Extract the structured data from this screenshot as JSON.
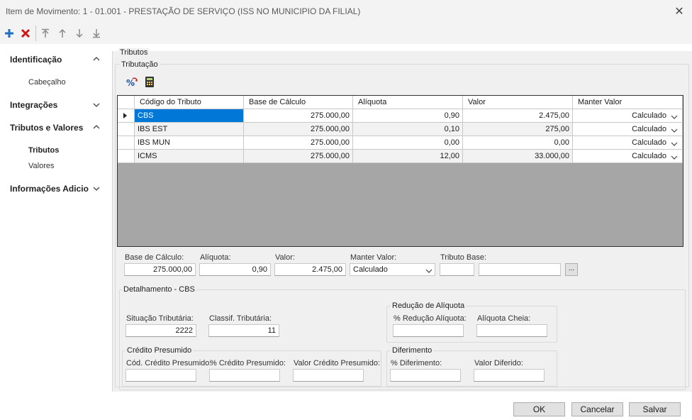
{
  "window": {
    "title": "Item de Movimento: 1 - 01.001 - PRESTAÇÃO DE SERVIÇO (ISS NO MUNICIPIO DA FILIAL)"
  },
  "toolbar": {
    "icons": [
      "add-icon",
      "delete-icon",
      "move-top-icon",
      "move-up-icon",
      "move-down-icon",
      "move-bottom-icon"
    ],
    "colors": {
      "add": "#1e6fc4",
      "delete": "#d01818",
      "disabled": "#8a8a8a"
    }
  },
  "nav": {
    "groups": [
      {
        "label": "Identificação",
        "items": [
          "Cabeçalho"
        ]
      },
      {
        "label": "Integrações"
      },
      {
        "label": "Tributos e Valores",
        "items": [
          "Tributos",
          "Valores"
        ]
      },
      {
        "label": "Informações Adicio"
      }
    ],
    "active_item": "Tributos"
  },
  "section": {
    "title": "Tributos",
    "subtitle": "Tributação"
  },
  "grid": {
    "columns": [
      "Código do Tributo",
      "Base de Cálculo",
      "Alíquota",
      "Valor",
      "Manter Valor"
    ],
    "rows": [
      [
        "CBS",
        "275.000,00",
        "0,90",
        "2.475,00",
        "Calculado"
      ],
      [
        "IBS EST",
        "275.000,00",
        "0,10",
        "275,00",
        "Calculado"
      ],
      [
        "IBS MUN",
        "275.000,00",
        "0,00",
        "0,00",
        "Calculado"
      ],
      [
        "ICMS",
        "275.000,00",
        "12,00",
        "33.000,00",
        "Calculado"
      ]
    ],
    "selected_color": "#0078d7"
  },
  "form": {
    "base_label": "Base de Cálculo:",
    "base_value": "275.000,00",
    "aliquota_label": "Alíquota:",
    "aliquota_value": "0,90",
    "valor_label": "Valor:",
    "valor_value": "2.475,00",
    "manter_label": "Manter Valor:",
    "manter_value": "Calculado",
    "tributo_base_label": "Tributo Base:",
    "tributo_base_code": "",
    "tributo_base_desc": "",
    "browse_label": "..."
  },
  "detalhamento": {
    "title": "Detalhamento - CBS",
    "situacao_label": "Situação Tributária:",
    "situacao_value": "2222",
    "classif_label": "Classif. Tributária:",
    "classif_value": "11",
    "reducao": {
      "title": "Redução de Alíquota",
      "pct_label": "% Redução Alíquota:",
      "pct_value": "",
      "cheia_label": "Alíquota Cheia:",
      "cheia_value": ""
    },
    "credito": {
      "title": "Crédito Presumido",
      "cod_label": "Cód. Crédito Presumido:",
      "cod_value": "",
      "pct_label": "% Crédito Presumido:",
      "pct_value": "",
      "valor_label": "Valor Crédito Presumido:",
      "valor_value": ""
    },
    "diferimento": {
      "title": "Diferimento",
      "pct_label": "% Diferimento:",
      "pct_value": "",
      "valor_label": "Valor Diferido:",
      "valor_value": ""
    }
  },
  "buttons": {
    "ok": "OK",
    "cancel": "Cancelar",
    "save": "Salvar"
  }
}
